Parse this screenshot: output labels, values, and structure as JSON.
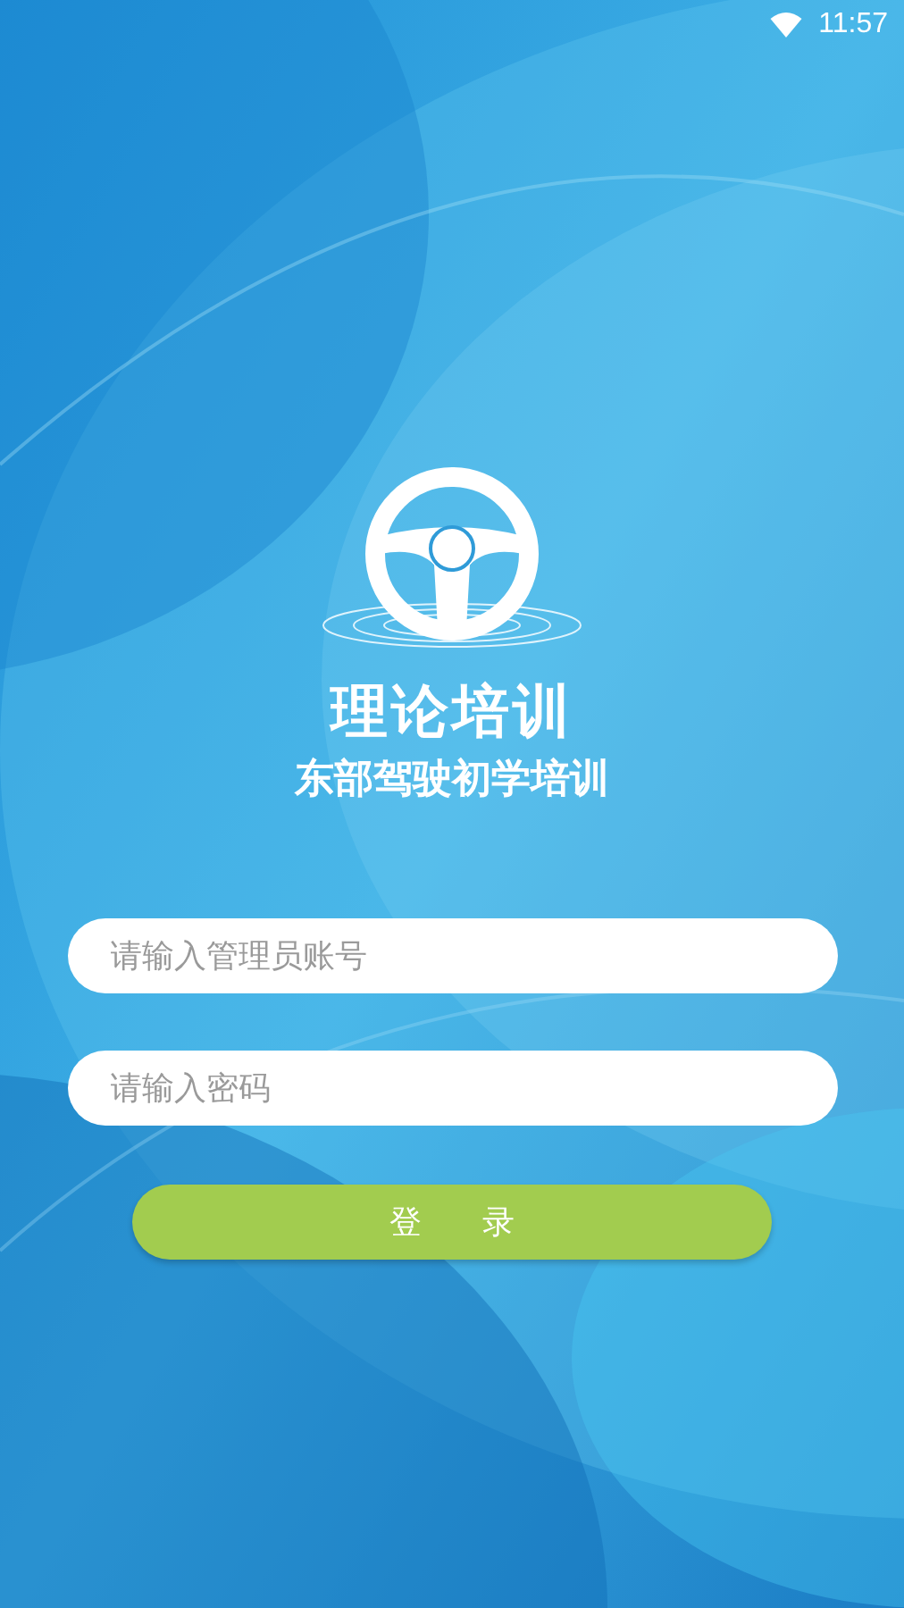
{
  "status_bar": {
    "time": "11:57"
  },
  "app": {
    "title": "理论培训",
    "subtitle": "东部驾驶初学培训"
  },
  "fields": [
    {
      "placeholder": "请输入管理员账号"
    },
    {
      "placeholder": "请输入密码"
    }
  ],
  "login_button": {
    "label": "登      录"
  }
}
